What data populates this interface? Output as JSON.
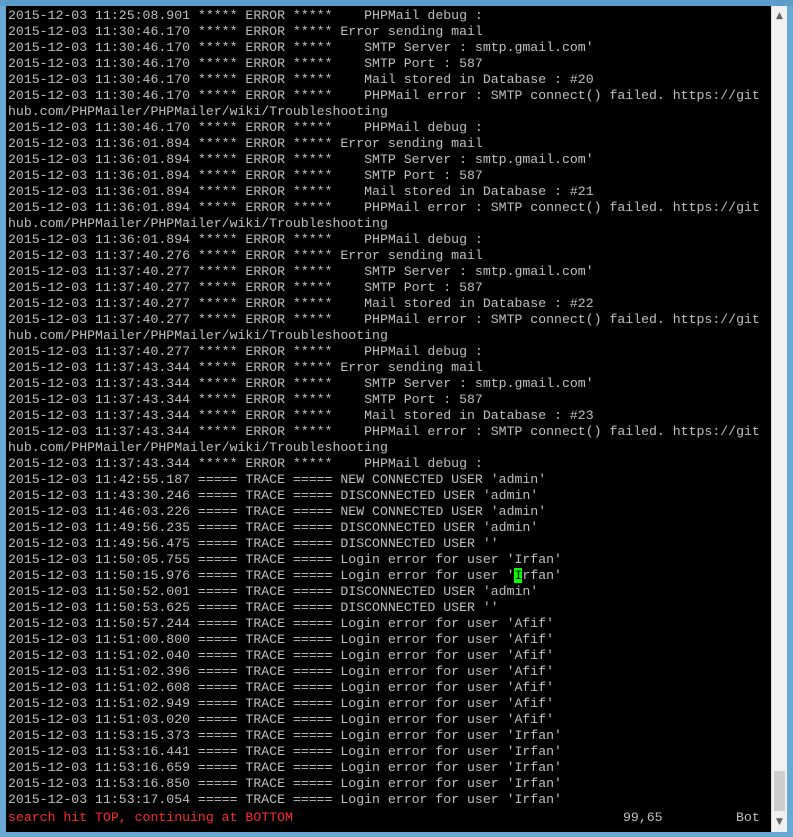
{
  "terminal": {
    "lines": [
      "2015-12-03 11:25:08.901 ***** ERROR *****    PHPMail debug :",
      "2015-12-03 11:30:46.170 ***** ERROR ***** Error sending mail",
      "2015-12-03 11:30:46.170 ***** ERROR *****    SMTP Server : smtp.gmail.com'",
      "2015-12-03 11:30:46.170 ***** ERROR *****    SMTP Port : 587",
      "2015-12-03 11:30:46.170 ***** ERROR *****    Mail stored in Database : #20",
      "2015-12-03 11:30:46.170 ***** ERROR *****    PHPMail error : SMTP connect() failed. https://git",
      "hub.com/PHPMailer/PHPMailer/wiki/Troubleshooting",
      "2015-12-03 11:30:46.170 ***** ERROR *****    PHPMail debug :",
      "2015-12-03 11:36:01.894 ***** ERROR ***** Error sending mail",
      "2015-12-03 11:36:01.894 ***** ERROR *****    SMTP Server : smtp.gmail.com'",
      "2015-12-03 11:36:01.894 ***** ERROR *****    SMTP Port : 587",
      "2015-12-03 11:36:01.894 ***** ERROR *****    Mail stored in Database : #21",
      "2015-12-03 11:36:01.894 ***** ERROR *****    PHPMail error : SMTP connect() failed. https://git",
      "hub.com/PHPMailer/PHPMailer/wiki/Troubleshooting",
      "2015-12-03 11:36:01.894 ***** ERROR *****    PHPMail debug :",
      "2015-12-03 11:37:40.276 ***** ERROR ***** Error sending mail",
      "2015-12-03 11:37:40.277 ***** ERROR *****    SMTP Server : smtp.gmail.com'",
      "2015-12-03 11:37:40.277 ***** ERROR *****    SMTP Port : 587",
      "2015-12-03 11:37:40.277 ***** ERROR *****    Mail stored in Database : #22",
      "2015-12-03 11:37:40.277 ***** ERROR *****    PHPMail error : SMTP connect() failed. https://git",
      "hub.com/PHPMailer/PHPMailer/wiki/Troubleshooting",
      "2015-12-03 11:37:40.277 ***** ERROR *****    PHPMail debug :",
      "2015-12-03 11:37:43.344 ***** ERROR ***** Error sending mail",
      "2015-12-03 11:37:43.344 ***** ERROR *****    SMTP Server : smtp.gmail.com'",
      "2015-12-03 11:37:43.344 ***** ERROR *****    SMTP Port : 587",
      "2015-12-03 11:37:43.344 ***** ERROR *****    Mail stored in Database : #23",
      "2015-12-03 11:37:43.344 ***** ERROR *****    PHPMail error : SMTP connect() failed. https://git",
      "hub.com/PHPMailer/PHPMailer/wiki/Troubleshooting",
      "2015-12-03 11:37:43.344 ***** ERROR *****    PHPMail debug :",
      "2015-12-03 11:42:55.187 ===== TRACE ===== NEW CONNECTED USER 'admin'",
      "2015-12-03 11:43:30.246 ===== TRACE ===== DISCONNECTED USER 'admin'",
      "2015-12-03 11:46:03.226 ===== TRACE ===== NEW CONNECTED USER 'admin'",
      "2015-12-03 11:49:56.235 ===== TRACE ===== DISCONNECTED USER 'admin'",
      "2015-12-03 11:49:56.475 ===== TRACE ===== DISCONNECTED USER ''",
      "2015-12-03 11:50:05.755 ===== TRACE ===== Login error for user 'Irfan'",
      "2015-12-03 11:50:15.976 ===== TRACE ===== Login error for user 'Irfan'",
      "2015-12-03 11:50:52.001 ===== TRACE ===== DISCONNECTED USER 'admin'",
      "2015-12-03 11:50:53.625 ===== TRACE ===== DISCONNECTED USER ''",
      "2015-12-03 11:50:57.244 ===== TRACE ===== Login error for user 'Afif'",
      "2015-12-03 11:51:00.800 ===== TRACE ===== Login error for user 'Afif'",
      "2015-12-03 11:51:02.040 ===== TRACE ===== Login error for user 'Afif'",
      "2015-12-03 11:51:02.396 ===== TRACE ===== Login error for user 'Afif'",
      "2015-12-03 11:51:02.608 ===== TRACE ===== Login error for user 'Afif'",
      "2015-12-03 11:51:02.949 ===== TRACE ===== Login error for user 'Afif'",
      "2015-12-03 11:51:03.020 ===== TRACE ===== Login error for user 'Afif'",
      "2015-12-03 11:53:15.373 ===== TRACE ===== Login error for user 'Irfan'",
      "2015-12-03 11:53:16.441 ===== TRACE ===== Login error for user 'Irfan'",
      "2015-12-03 11:53:16.659 ===== TRACE ===== Login error for user 'Irfan'",
      "2015-12-03 11:53:16.850 ===== TRACE ===== Login error for user 'Irfan'",
      "2015-12-03 11:53:17.054 ===== TRACE ===== Login error for user 'Irfan'"
    ],
    "cursor": {
      "line": 35,
      "column": 65
    }
  },
  "status": {
    "message": "search hit TOP, continuing at BOTTOM",
    "position": "99,65",
    "scroll": "Bot"
  },
  "colors": {
    "background": "#000000",
    "text": "#c0c0c0",
    "cursor": "#00ff00",
    "status_message": "#ff2a2a"
  },
  "icons": {
    "scroll_up": "chevron-up-icon",
    "scroll_down": "chevron-down-icon"
  }
}
